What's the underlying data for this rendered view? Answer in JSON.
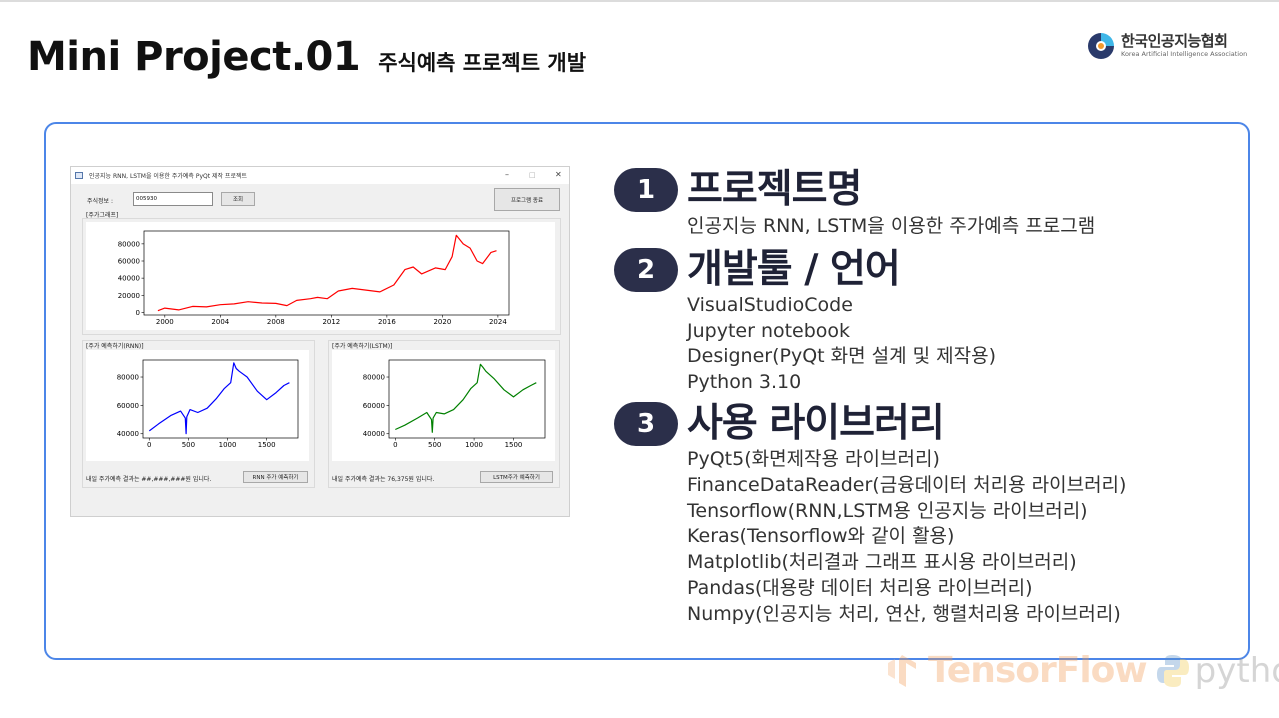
{
  "header": {
    "title": "Mini Project.01",
    "subtitle": "주식예측 프로젝트 개발"
  },
  "logo": {
    "name_ko": "한국인공지능협회",
    "name_en": "Korea Artificial Intelligence Association",
    "colors": [
      "#2a3a6b",
      "#3fb7e8",
      "#f29a2e"
    ]
  },
  "app_window": {
    "title": "인공지능 RNN, LSTM을 이용한 주가예측 PyQt 제작 프로젝트",
    "controls": {
      "minimize": "–",
      "maximize": "□",
      "close": "✕"
    },
    "stock_label": "주식정보 :",
    "stock_value": "005930",
    "search_button": "조회",
    "exit_button": "프로그램 종료",
    "price_panel_label": "[주가그래프]",
    "rnn_panel_label": "[주가 예측하기(RNN)]",
    "lstm_panel_label": "[주가 예측하기(LSTM)]",
    "rnn_result": "내일 주가예측 결과는 ##,###,###원 입니다.",
    "lstm_result": "내일 주가예측 결과는 76,375원 입니다.",
    "rnn_button": "RNN 주가 예측하기",
    "lstm_button": "LSTM주가 예측하기"
  },
  "chart_data": [
    {
      "type": "line",
      "color": "#ff0000",
      "x_ticks": [
        "2000",
        "2004",
        "2008",
        "2012",
        "2016",
        "2020",
        "2024"
      ],
      "y_ticks": [
        "0",
        "20000",
        "40000",
        "60000",
        "80000"
      ],
      "xlim": [
        1998.5,
        2024.8
      ],
      "ylim": [
        -3000,
        95000
      ],
      "series": [
        {
          "x": [
            1999.5,
            2000.0,
            2001.0,
            2002.0,
            2003.0,
            2004.0,
            2005.0,
            2006.0,
            2007.0,
            2008.0,
            2008.8,
            2009.5,
            2010.5,
            2011.0,
            2011.7,
            2012.5,
            2013.5,
            2014.5,
            2015.5,
            2016.5,
            2017.3,
            2017.9,
            2018.5,
            2019.5,
            2020.2,
            2020.7,
            2021.0,
            2021.5,
            2022.0,
            2022.5,
            2022.9,
            2023.5,
            2023.9
          ],
          "y": [
            2000,
            5000,
            3000,
            7000,
            6500,
            9000,
            10000,
            12500,
            11000,
            10500,
            8000,
            14000,
            16000,
            17500,
            16000,
            25000,
            28000,
            26000,
            24000,
            32000,
            50000,
            53000,
            45000,
            52000,
            50000,
            65000,
            90000,
            80000,
            75000,
            60000,
            57000,
            70000,
            72000
          ]
        }
      ]
    },
    {
      "type": "line",
      "color": "#0000ff",
      "x_ticks": [
        "0",
        "500",
        "1000",
        "1500"
      ],
      "y_ticks": [
        "40000",
        "60000",
        "80000"
      ],
      "xlim": [
        -80,
        1900
      ],
      "ylim": [
        37000,
        92000
      ],
      "series": [
        {
          "x": [
            0,
            120,
            280,
            400,
            460,
            470,
            480,
            520,
            620,
            740,
            860,
            960,
            1040,
            1080,
            1110,
            1150,
            1250,
            1380,
            1500,
            1620,
            1720,
            1790
          ],
          "y": [
            42000,
            47000,
            53000,
            56000,
            51000,
            40000,
            52000,
            57000,
            55000,
            58000,
            65000,
            72000,
            76000,
            90000,
            86000,
            84000,
            80000,
            70000,
            64000,
            69000,
            74000,
            76000
          ]
        }
      ]
    },
    {
      "type": "line",
      "color": "#008000",
      "x_ticks": [
        "0",
        "500",
        "1000",
        "1500"
      ],
      "y_ticks": [
        "40000",
        "60000",
        "80000"
      ],
      "xlim": [
        -80,
        1900
      ],
      "ylim": [
        37000,
        92000
      ],
      "series": [
        {
          "x": [
            0,
            120,
            280,
            400,
            460,
            470,
            480,
            520,
            620,
            740,
            860,
            960,
            1040,
            1080,
            1110,
            1150,
            1250,
            1380,
            1500,
            1620,
            1720,
            1790
          ],
          "y": [
            43000,
            46000,
            51000,
            55000,
            50000,
            41000,
            51000,
            55000,
            54000,
            57000,
            64000,
            72000,
            76000,
            89000,
            87000,
            84000,
            79000,
            71000,
            66000,
            71000,
            74000,
            76000
          ]
        }
      ]
    }
  ],
  "sections": [
    {
      "number": "1",
      "title": "프로젝트명",
      "items": [
        "인공지능 RNN, LSTM을 이용한 주가예측 프로그램"
      ]
    },
    {
      "number": "2",
      "title": "개발툴 / 언어",
      "items": [
        "VisualStudioCode",
        "Jupyter notebook",
        "Designer(PyQt 화면 설계 및 제작용)",
        "Python 3.10"
      ]
    },
    {
      "number": "3",
      "title": "사용 라이브러리",
      "items": [
        "PyQt5(화면제작용 라이브러리)",
        "FinanceDataReader(금융데이터 처리용 라이브러리)",
        "Tensorflow(RNN,LSTM용 인공지능 라이브러리)",
        "Keras(Tensorflow와 같이 활용)",
        "Matplotlib(처리결과 그래프 표시용 라이브러리)",
        "Pandas(대용량 데이터 처리용 라이브러리)",
        "Numpy(인공지능 처리, 연산, 행렬처리용 라이브러리)"
      ]
    }
  ],
  "watermark": {
    "tensorflow": "TensorFlow",
    "python": "python"
  }
}
